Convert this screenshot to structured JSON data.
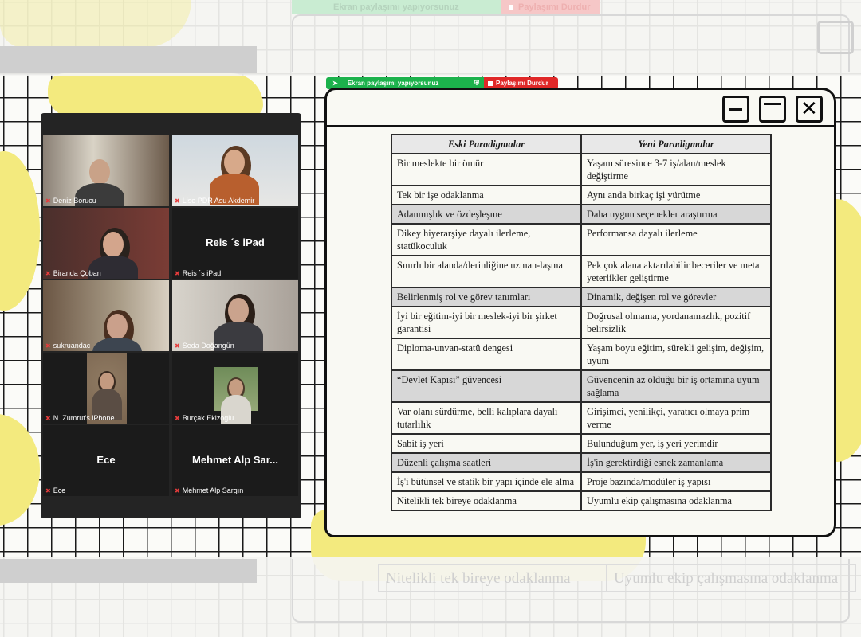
{
  "ghost": {
    "share_text": "Ekran paylaşımı yapıyorsunuz",
    "stop_text": "Paylaşımı Durdur",
    "row_left": "Nitelikli tek bireye odaklanma",
    "row_right": "Uyumlu ekip çalışmasına odaklanma"
  },
  "sharebar": {
    "share_text": "Ekran paylaşımı yapıyorsunuz",
    "stop_label": "Paylaşımı Durdur"
  },
  "table": {
    "headers": [
      "Eski Paradigmalar",
      "Yeni Paradigmalar"
    ],
    "rows": [
      {
        "old": "Bir meslekte bir ömür",
        "new": "Yaşam süresince 3-7 iş/alan/meslek değiştirme"
      },
      {
        "old": "Tek bir işe odaklanma",
        "new": "Aynı anda birkaç işi yürütme"
      },
      {
        "old": "Adanmışlık ve özdeşleşme",
        "new": "Daha uygun seçenekler araştırma"
      },
      {
        "old": "Dikey hiyerarşiye dayalı ilerleme, statükoculuk",
        "new": "Performansa dayalı ilerleme"
      },
      {
        "old": "Sınırlı bir alanda/derinliğine uzman-laşma",
        "new": "Pek çok alana aktarılabilir beceriler ve meta yeterlikler geliştirme"
      },
      {
        "old": "Belirlenmiş rol ve görev tanımları",
        "new": "Dinamik, değişen rol ve görevler"
      },
      {
        "old": "İyi bir eğitim-iyi bir meslek-iyi bir şirket garantisi",
        "new": "Doğrusal olmama, yordanamazlık, pozitif belirsizlik"
      },
      {
        "old": "Diploma-unvan-statü dengesi",
        "new": "Yaşam boyu eğitim, sürekli gelişim, değişim, uyum"
      },
      {
        "old": "“Devlet Kapısı” güvencesi",
        "new": "Güvencenin az olduğu bir iş ortamına uyum sağlama"
      },
      {
        "old": "Var olanı sürdürme, belli kalıplara dayalı tutarlılık",
        "new": "Girişimci, yenilikçi, yaratıcı olmaya prim verme"
      },
      {
        "old": "Sabit iş yeri",
        "new": "Bulunduğum yer, iş yeri yerimdir"
      },
      {
        "old": "Düzenli çalışma saatleri",
        "new": "İş'in gerektirdiği esnek zamanlama"
      },
      {
        "old": "İş'i bütünsel ve statik bir yapı içinde ele alma",
        "new": "Proje bazında/modüler iş yapısı"
      },
      {
        "old": "Nitelikli tek bireye odaklanma",
        "new": "Uyumlu ekip çalışmasına odaklanma"
      }
    ]
  },
  "participants": [
    {
      "name": "Deniz Borucu",
      "video": true
    },
    {
      "name": "Lise PDR Asu Akdemir",
      "video": true,
      "active": true
    },
    {
      "name": "Biranda Çoban",
      "video": true
    },
    {
      "name": "Reis ´s iPad",
      "display": "Reis ´s iPad",
      "video": false
    },
    {
      "name": "sukruandac",
      "video": true
    },
    {
      "name": "Seda Doğangün",
      "video": true
    },
    {
      "name": "N. Zumrut's iPhone",
      "video": true
    },
    {
      "name": "Burçak Ekizoglu",
      "video": true
    },
    {
      "name": "Ece",
      "display": "Ece",
      "video": false
    },
    {
      "name": "Mehmet Alp Sargın",
      "display": "Mehmet  Alp  Sar...",
      "video": false
    }
  ],
  "colors": {
    "share_green": "#1cb24c",
    "stop_red": "#e02828",
    "active_border": "#c5e046",
    "blob_yellow": "#f3ea7e"
  }
}
